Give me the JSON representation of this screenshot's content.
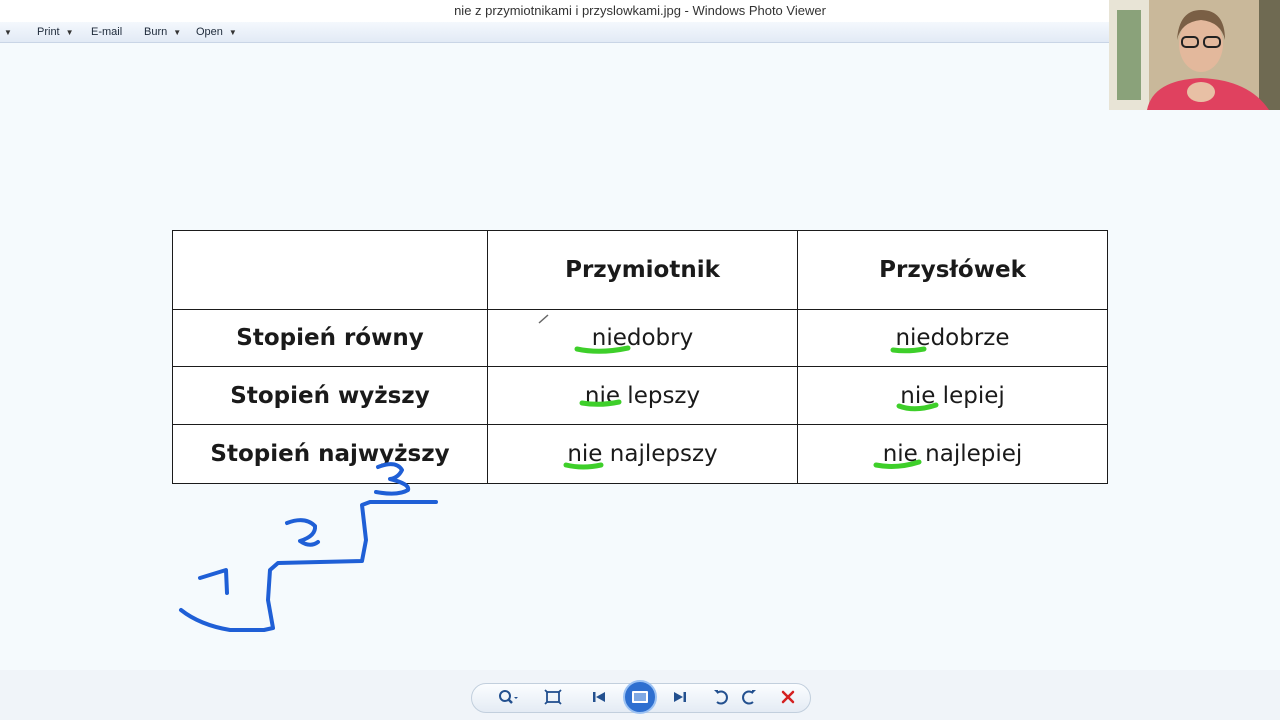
{
  "window": {
    "title": "nie z przymiotnikami i przyslowkami.jpg - Windows Photo Viewer"
  },
  "menu": [
    {
      "label": ""
    },
    {
      "label": "Print"
    },
    {
      "label": "E-mail"
    },
    {
      "label": "Burn"
    },
    {
      "label": "Open"
    }
  ],
  "table": {
    "headers": [
      "",
      "Przymiotnik",
      "Przysłówek"
    ],
    "rows": [
      {
        "label": "Stopień równy",
        "adjective": "niedobry",
        "adverb": "niedobrze"
      },
      {
        "label": "Stopień wyższy",
        "adjective": "nie lepszy",
        "adverb": "nie lepiej"
      },
      {
        "label": "Stopień najwyższy",
        "adjective": "nie najlepszy",
        "adverb": "nie najlepiej"
      }
    ]
  },
  "annotations": {
    "step_numbers": [
      "1",
      "2",
      "3"
    ],
    "underline_color": "#3ecf2a",
    "stair_color": "#1f5fd6"
  },
  "toolbar": {
    "buttons": [
      "zoom-icon",
      "fit-window-icon",
      "previous-icon",
      "slideshow-icon",
      "next-icon",
      "rotate-left-icon",
      "rotate-right-icon",
      "delete-icon"
    ]
  }
}
